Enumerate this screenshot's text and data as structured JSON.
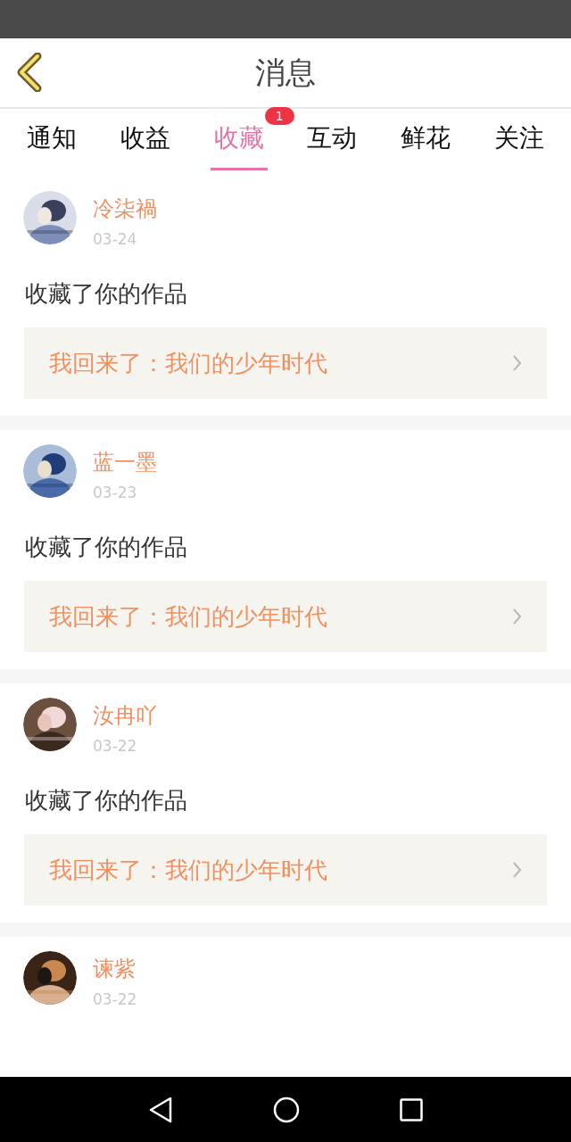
{
  "header": {
    "title": "消息"
  },
  "tabs": [
    {
      "label": "通知",
      "selected": false
    },
    {
      "label": "收益",
      "selected": false
    },
    {
      "label": "收藏",
      "selected": true,
      "badge": "1"
    },
    {
      "label": "互动",
      "selected": false
    },
    {
      "label": "鲜花",
      "selected": false
    },
    {
      "label": "关注",
      "selected": false
    }
  ],
  "messages": [
    {
      "name": "冷柒禍",
      "date": "03-24",
      "text": "收藏了你的作品",
      "work": "我回来了：我们的少年时代"
    },
    {
      "name": "蓝一墨",
      "date": "03-23",
      "text": "收藏了你的作品",
      "work": "我回来了：我们的少年时代"
    },
    {
      "name": "汝冉吖",
      "date": "03-22",
      "text": "收藏了你的作品",
      "work": "我回来了：我们的少年时代"
    },
    {
      "name": "谏紫",
      "date": "03-22"
    }
  ]
}
